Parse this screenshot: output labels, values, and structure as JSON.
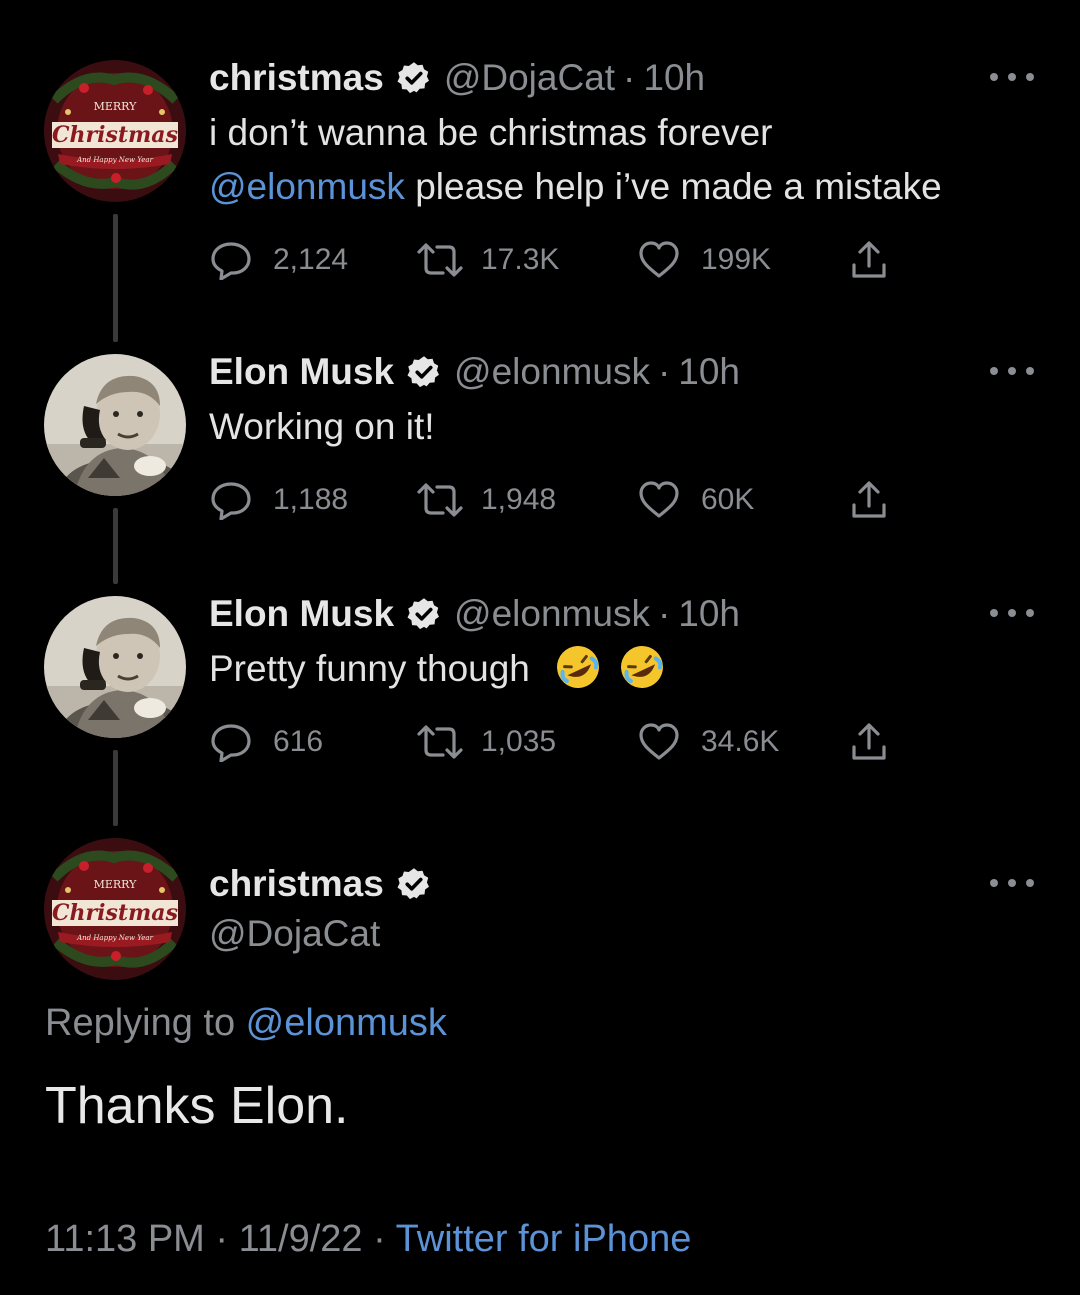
{
  "tweets": [
    {
      "name": "christmas",
      "handle": "@DojaCat",
      "time": "10h",
      "avatar": "merry-christmas-badge",
      "avatar_text": {
        "top": "MERRY",
        "main": "Christmas",
        "sub": "And Happy New Year"
      },
      "text_line1": "i don’t wanna be christmas forever",
      "text_mention": "@elonmusk",
      "text_line2_rest": " please help i’ve made a mistake",
      "replies": "2,124",
      "retweets": "17.3K",
      "likes": "199K"
    },
    {
      "name": "Elon Musk",
      "handle": "@elonmusk",
      "time": "10h",
      "avatar": "child-on-phone-photo",
      "text": "Working on it!",
      "replies": "1,188",
      "retweets": "1,948",
      "likes": "60K"
    },
    {
      "name": "Elon Musk",
      "handle": "@elonmusk",
      "time": "10h",
      "avatar": "child-on-phone-photo",
      "text": "Pretty funny though",
      "emojis": [
        "rolling-on-floor-laughing",
        "rolling-on-floor-laughing"
      ],
      "replies": "616",
      "retweets": "1,035",
      "likes": "34.6K"
    }
  ],
  "main_tweet": {
    "name": "christmas",
    "handle": "@DojaCat",
    "avatar": "merry-christmas-badge",
    "replying_prefix": "Replying to ",
    "replying_handle": "@elonmusk",
    "text": "Thanks Elon.",
    "timestamp": "11:13 PM · 11/9/22 · ",
    "source": "Twitter for iPhone"
  },
  "colors": {
    "background": "#000000",
    "text": "#e3e3e3",
    "muted": "#8a8d91",
    "link": "#5b93d6",
    "thread_line": "#3a3a3a"
  },
  "icons": [
    "reply-icon",
    "retweet-icon",
    "like-icon",
    "share-icon",
    "verified-badge-icon",
    "more-options-icon"
  ]
}
